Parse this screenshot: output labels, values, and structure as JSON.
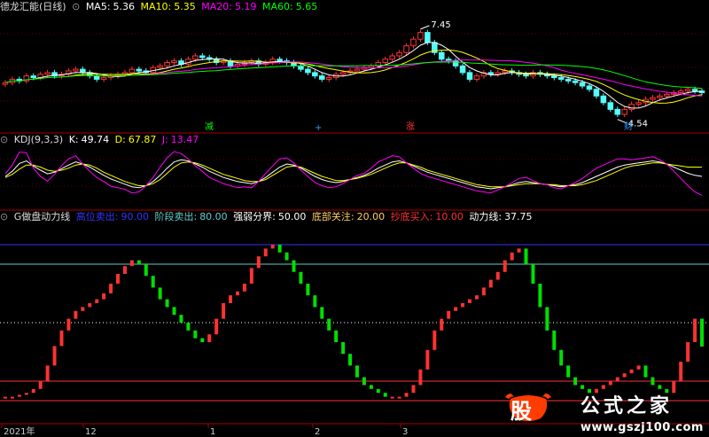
{
  "header_price": {
    "stock": "德龙汇能(日线)",
    "ma5_label": "MA5:",
    "ma5": "5.36",
    "ma10_label": "MA10:",
    "ma10": "5.35",
    "ma20_label": "MA20:",
    "ma20": "5.19",
    "ma60_label": "MA60:",
    "ma60": "5.65"
  },
  "header_kdj": {
    "name": "KDJ(9,3,3)",
    "k_label": "K:",
    "k": "49.74",
    "d_label": "D:",
    "d": "67.87",
    "j_label": "J:",
    "j": "13.47"
  },
  "header_ind": {
    "name": "G做盘动力线",
    "l1": "高位卖出:",
    "v1": "90.00",
    "l2": "阶段卖出:",
    "v2": "80.00",
    "l3": "强弱分界:",
    "v3": "50.00",
    "l4": "底部关注:",
    "v4": "20.00",
    "l5": "抄底买入:",
    "v5": "10.00",
    "l6": "动力线:",
    "v6": "37.75"
  },
  "annotations": {
    "high": "7.45",
    "low": "4.54",
    "m1": "减",
    "m2": "+",
    "m3": "涨",
    "m4": "财"
  },
  "date_axis": [
    "2021年",
    "12",
    "1",
    "2",
    "3"
  ],
  "watermark": {
    "logo": "股",
    "title": "公式之家",
    "url": "www.gszj100.com"
  },
  "colors": {
    "up": "#ff3232",
    "down": "#54fcfc",
    "ma5": "#ffffff",
    "ma10": "#ffff00",
    "ma20": "#ff00ff",
    "ma60": "#00ff00",
    "k": "#ffffff",
    "d": "#ffff00",
    "j": "#ff00ff",
    "power_up": "#ff3232",
    "power_down": "#00e000",
    "line90": "#3333ff",
    "line80": "#66cccc",
    "line20": "#ff3232",
    "line10": "#ff3232"
  },
  "chart_data": [
    {
      "type": "candlestick",
      "title": "德龙汇能(日线)",
      "ylim": [
        4.3,
        7.8
      ],
      "note": "approximate daily closes, 100 bars",
      "close": [
        5.7,
        5.8,
        5.75,
        5.9,
        5.85,
        5.95,
        6.0,
        5.9,
        5.95,
        6.05,
        6.1,
        6.0,
        5.9,
        5.8,
        5.85,
        5.9,
        5.95,
        6.0,
        6.1,
        6.05,
        6.0,
        6.15,
        6.2,
        6.3,
        6.35,
        6.25,
        6.4,
        6.5,
        6.45,
        6.4,
        6.3,
        6.35,
        6.2,
        6.25,
        6.3,
        6.35,
        6.25,
        6.3,
        6.4,
        6.35,
        6.3,
        6.2,
        6.1,
        6.0,
        5.9,
        5.8,
        5.85,
        5.95,
        6.0,
        6.05,
        6.1,
        6.15,
        6.2,
        6.3,
        6.4,
        6.5,
        6.6,
        6.8,
        7.0,
        7.2,
        6.9,
        6.6,
        6.4,
        6.35,
        6.2,
        6.0,
        5.8,
        5.9,
        6.0,
        5.95,
        6.0,
        6.05,
        6.0,
        5.95,
        5.9,
        6.0,
        5.95,
        5.9,
        5.85,
        5.8,
        5.75,
        5.7,
        5.6,
        5.5,
        5.3,
        5.1,
        4.9,
        4.75,
        4.9,
        5.05,
        5.1,
        5.2,
        5.25,
        5.3,
        5.35,
        5.4,
        5.45,
        5.5,
        5.45,
        5.4
      ]
    },
    {
      "type": "line",
      "title": "KDJ(9,3,3)",
      "ylim": [
        -10,
        110
      ],
      "series": [
        {
          "name": "K",
          "values": [
            50,
            60,
            75,
            80,
            70,
            62,
            55,
            58,
            65,
            72,
            78,
            74,
            68,
            60,
            52,
            45,
            40,
            35,
            30,
            28,
            32,
            40,
            52,
            66,
            78,
            82,
            80,
            74,
            68,
            60,
            54,
            48,
            44,
            40,
            38,
            36,
            40,
            48,
            58,
            68,
            74,
            72,
            66,
            58,
            50,
            44,
            40,
            38,
            40,
            44,
            48,
            52,
            58,
            66,
            72,
            78,
            80,
            76,
            70,
            64,
            58,
            54,
            50,
            46,
            42,
            38,
            34,
            30,
            28,
            26,
            28,
            30,
            34,
            38,
            40,
            38,
            36,
            34,
            32,
            30,
            32,
            34,
            38,
            44,
            50,
            56,
            62,
            68,
            72,
            74,
            76,
            78,
            80,
            78,
            74,
            68,
            62,
            56,
            52,
            50
          ]
        },
        {
          "name": "D",
          "values": [
            48,
            54,
            64,
            72,
            72,
            68,
            62,
            60,
            62,
            66,
            72,
            74,
            72,
            66,
            58,
            52,
            46,
            40,
            36,
            32,
            32,
            36,
            44,
            56,
            68,
            76,
            78,
            76,
            72,
            66,
            60,
            54,
            50,
            46,
            42,
            40,
            40,
            44,
            52,
            60,
            68,
            70,
            68,
            62,
            56,
            50,
            46,
            42,
            42,
            44,
            46,
            50,
            54,
            60,
            66,
            72,
            76,
            76,
            72,
            68,
            62,
            58,
            54,
            50,
            46,
            42,
            38,
            34,
            32,
            30,
            30,
            30,
            32,
            34,
            36,
            36,
            36,
            34,
            34,
            32,
            32,
            32,
            34,
            38,
            42,
            48,
            54,
            60,
            66,
            70,
            72,
            74,
            76,
            76,
            74,
            72,
            70,
            68,
            68,
            67.87
          ]
        },
        {
          "name": "J",
          "values": [
            55,
            72,
            97,
            96,
            66,
            50,
            41,
            54,
            71,
            84,
            90,
            74,
            60,
            48,
            40,
            31,
            28,
            25,
            18,
            20,
            32,
            48,
            68,
            86,
            98,
            94,
            84,
            70,
            60,
            48,
            42,
            36,
            32,
            28,
            30,
            28,
            40,
            56,
            70,
            84,
            86,
            76,
            62,
            50,
            38,
            32,
            28,
            30,
            36,
            44,
            52,
            56,
            66,
            78,
            84,
            90,
            88,
            76,
            66,
            56,
            50,
            46,
            42,
            38,
            34,
            30,
            26,
            22,
            20,
            18,
            24,
            30,
            38,
            46,
            48,
            42,
            36,
            34,
            28,
            26,
            32,
            38,
            46,
            56,
            66,
            72,
            78,
            84,
            84,
            82,
            84,
            86,
            88,
            82,
            74,
            60,
            46,
            32,
            20,
            13.47
          ]
        }
      ]
    },
    {
      "type": "bar",
      "title": "G做盘动力线",
      "ylim": [
        0,
        100
      ],
      "reference_lines": [
        90,
        80,
        50,
        20,
        10
      ],
      "note": "approximate 动力线 values per bar",
      "values": [
        12,
        12,
        13,
        14,
        16,
        20,
        28,
        38,
        46,
        52,
        56,
        58,
        60,
        62,
        65,
        70,
        75,
        79,
        82,
        80,
        74,
        68,
        62,
        58,
        54,
        50,
        46,
        42,
        40,
        44,
        52,
        60,
        64,
        66,
        70,
        78,
        84,
        88,
        90,
        86,
        82,
        76,
        70,
        64,
        58,
        52,
        46,
        40,
        34,
        28,
        22,
        18,
        16,
        14,
        12,
        12,
        12,
        14,
        18,
        26,
        36,
        46,
        52,
        56,
        58,
        60,
        62,
        64,
        68,
        72,
        76,
        82,
        86,
        88,
        80,
        70,
        58,
        46,
        36,
        28,
        22,
        18,
        16,
        14,
        16,
        18,
        20,
        22,
        24,
        26,
        28,
        22,
        18,
        16,
        14,
        20,
        30,
        40,
        52,
        37.75
      ]
    }
  ]
}
